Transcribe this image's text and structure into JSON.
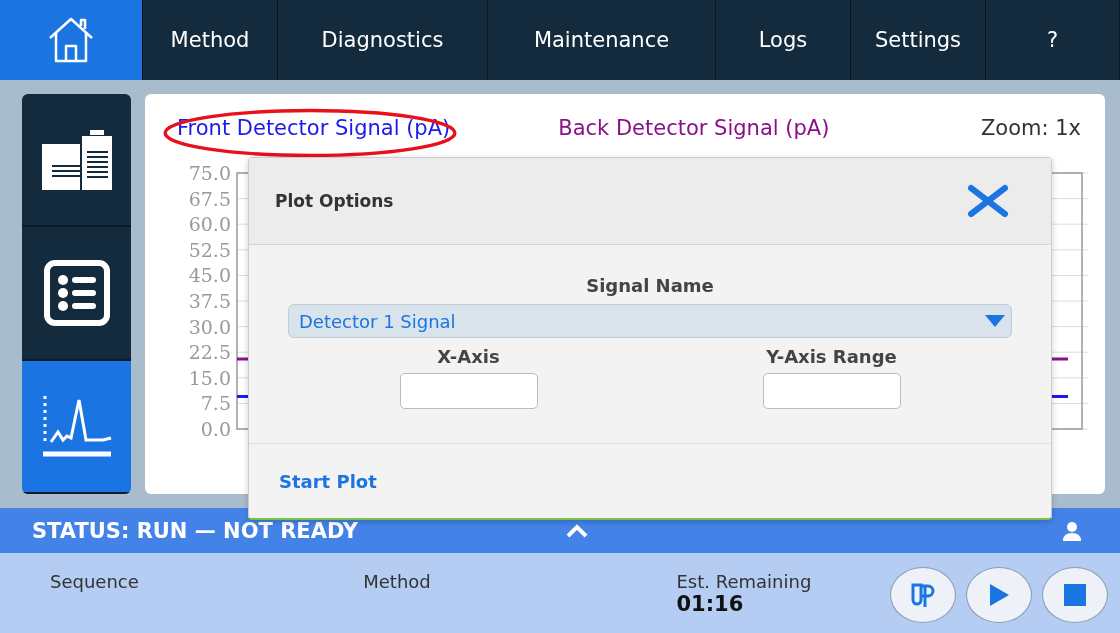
{
  "nav": {
    "items": [
      {
        "kind": "home",
        "selected": true
      },
      {
        "kind": "text",
        "label": "Method",
        "selected": false
      },
      {
        "kind": "text",
        "label": "Diagnostics",
        "selected": false
      },
      {
        "kind": "text",
        "label": "Maintenance",
        "selected": false
      },
      {
        "kind": "text",
        "label": "Logs",
        "selected": false
      },
      {
        "kind": "text",
        "label": "Settings",
        "selected": false
      },
      {
        "kind": "text",
        "label": "?",
        "selected": false
      }
    ]
  },
  "sidebar": {
    "items": [
      {
        "kind": "instrument",
        "selected": false
      },
      {
        "kind": "list",
        "selected": false
      },
      {
        "kind": "chromatogram",
        "selected": true
      }
    ]
  },
  "plot": {
    "zoom": "Zoom: 1x",
    "y_axis_labels": [
      "75.0",
      "67.5",
      "60.0",
      "52.5",
      "45.0",
      "37.5",
      "30.0",
      "22.5",
      "15.0",
      "7.5",
      "0.0"
    ],
    "series": [
      {
        "name": "Front Detector Signal (pA)",
        "color": "#1a1aee"
      },
      {
        "name": "Back Detector Signal (pA)",
        "color": "#8a108a"
      }
    ]
  },
  "dialog": {
    "title": "Plot Options",
    "signal_label": "Signal Name",
    "signal_value": "Detector 1 Signal",
    "x_axis_label": "X-Axis",
    "y_axis_label": "Y-Axis Range",
    "action": "Start Plot"
  },
  "status_bar": {
    "text": "STATUS: RUN — NOT READY",
    "fields": [
      {
        "label": "Sequence"
      },
      {
        "label": "Method"
      },
      {
        "label": "Est. Remaining",
        "value": "01:16"
      }
    ],
    "buttons": [
      {
        "kind": "vial"
      },
      {
        "kind": "play"
      },
      {
        "kind": "stop"
      }
    ]
  }
}
